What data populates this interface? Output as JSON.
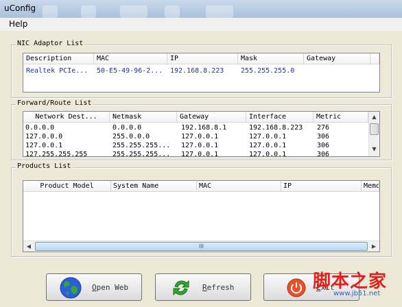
{
  "window": {
    "title": "uConfig"
  },
  "menu": {
    "help": "Help"
  },
  "nic": {
    "title": "NIC Adaptor List",
    "columns": [
      "Description",
      "MAC",
      "IP",
      "Mask",
      "Gateway"
    ],
    "rows": [
      {
        "description": "Realtek PCIe...",
        "mac": "50-E5-49-96-2...",
        "ip": "192.168.8.223",
        "mask": "255.255.255.0",
        "gateway": ""
      }
    ]
  },
  "route": {
    "title": "Forward/Route List",
    "columns": [
      "Network Dest...",
      "Netmask",
      "Gateway",
      "Interface",
      "Metric"
    ],
    "rows": [
      [
        "0.0.0.0",
        "0.0.0.0",
        "192.168.8.1",
        "192.168.8.223",
        "276"
      ],
      [
        "127.0.0.0",
        "255.0.0.0",
        "127.0.0.1",
        "127.0.0.1",
        "306"
      ],
      [
        "127.0.0.1",
        "255.255.255...",
        "127.0.0.1",
        "127.0.0.1",
        "306"
      ],
      [
        "127.255.255.255",
        "255.255.255...",
        "127.0.0.1",
        "127.0.0.1",
        "306"
      ]
    ]
  },
  "products": {
    "title": "Products List",
    "columns": [
      "Product Model",
      "System Name",
      "MAC",
      "IP",
      "Memo"
    ],
    "scroll_thumb": "III"
  },
  "buttons": {
    "open_web_mnemonic": "O",
    "open_web_rest": "pen Web",
    "refresh_mnemonic": "R",
    "refresh_rest": "efresh",
    "exit_mnemonic": "E",
    "exit_rest": "xit"
  },
  "watermark": {
    "text": "脚本之家",
    "url": "www.jb51.net"
  }
}
